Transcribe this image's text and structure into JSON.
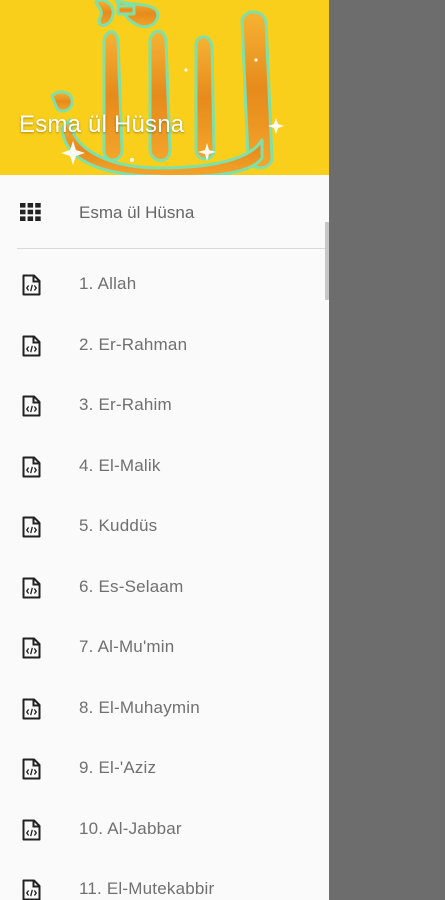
{
  "header": {
    "title": "Esma ül Hüsna",
    "background_color": "#f9cf1b",
    "art_icon": "allah-calligraphy-icon"
  },
  "section": {
    "label": "Esma ül Hüsna",
    "icon": "grid-icon"
  },
  "items": [
    {
      "label": "1. Allah",
      "icon": "code-file-icon"
    },
    {
      "label": "2. Er-Rahman",
      "icon": "code-file-icon"
    },
    {
      "label": "3. Er-Rahim",
      "icon": "code-file-icon"
    },
    {
      "label": "4. El-Malik",
      "icon": "code-file-icon"
    },
    {
      "label": "5. Kuddüs",
      "icon": "code-file-icon"
    },
    {
      "label": "6. Es-Selaam",
      "icon": "code-file-icon"
    },
    {
      "label": "7. Al-Mu'min",
      "icon": "code-file-icon"
    },
    {
      "label": "8. El-Muhaymin",
      "icon": "code-file-icon"
    },
    {
      "label": "9. El-'Aziz",
      "icon": "code-file-icon"
    },
    {
      "label": "10. Al-Jabbar",
      "icon": "code-file-icon"
    },
    {
      "label": "11. El-Mutekabbir",
      "icon": "code-file-icon"
    }
  ],
  "colors": {
    "scrim": "#6d6d6d",
    "drawer_bg": "#fafafa",
    "label_text": "#707070"
  }
}
